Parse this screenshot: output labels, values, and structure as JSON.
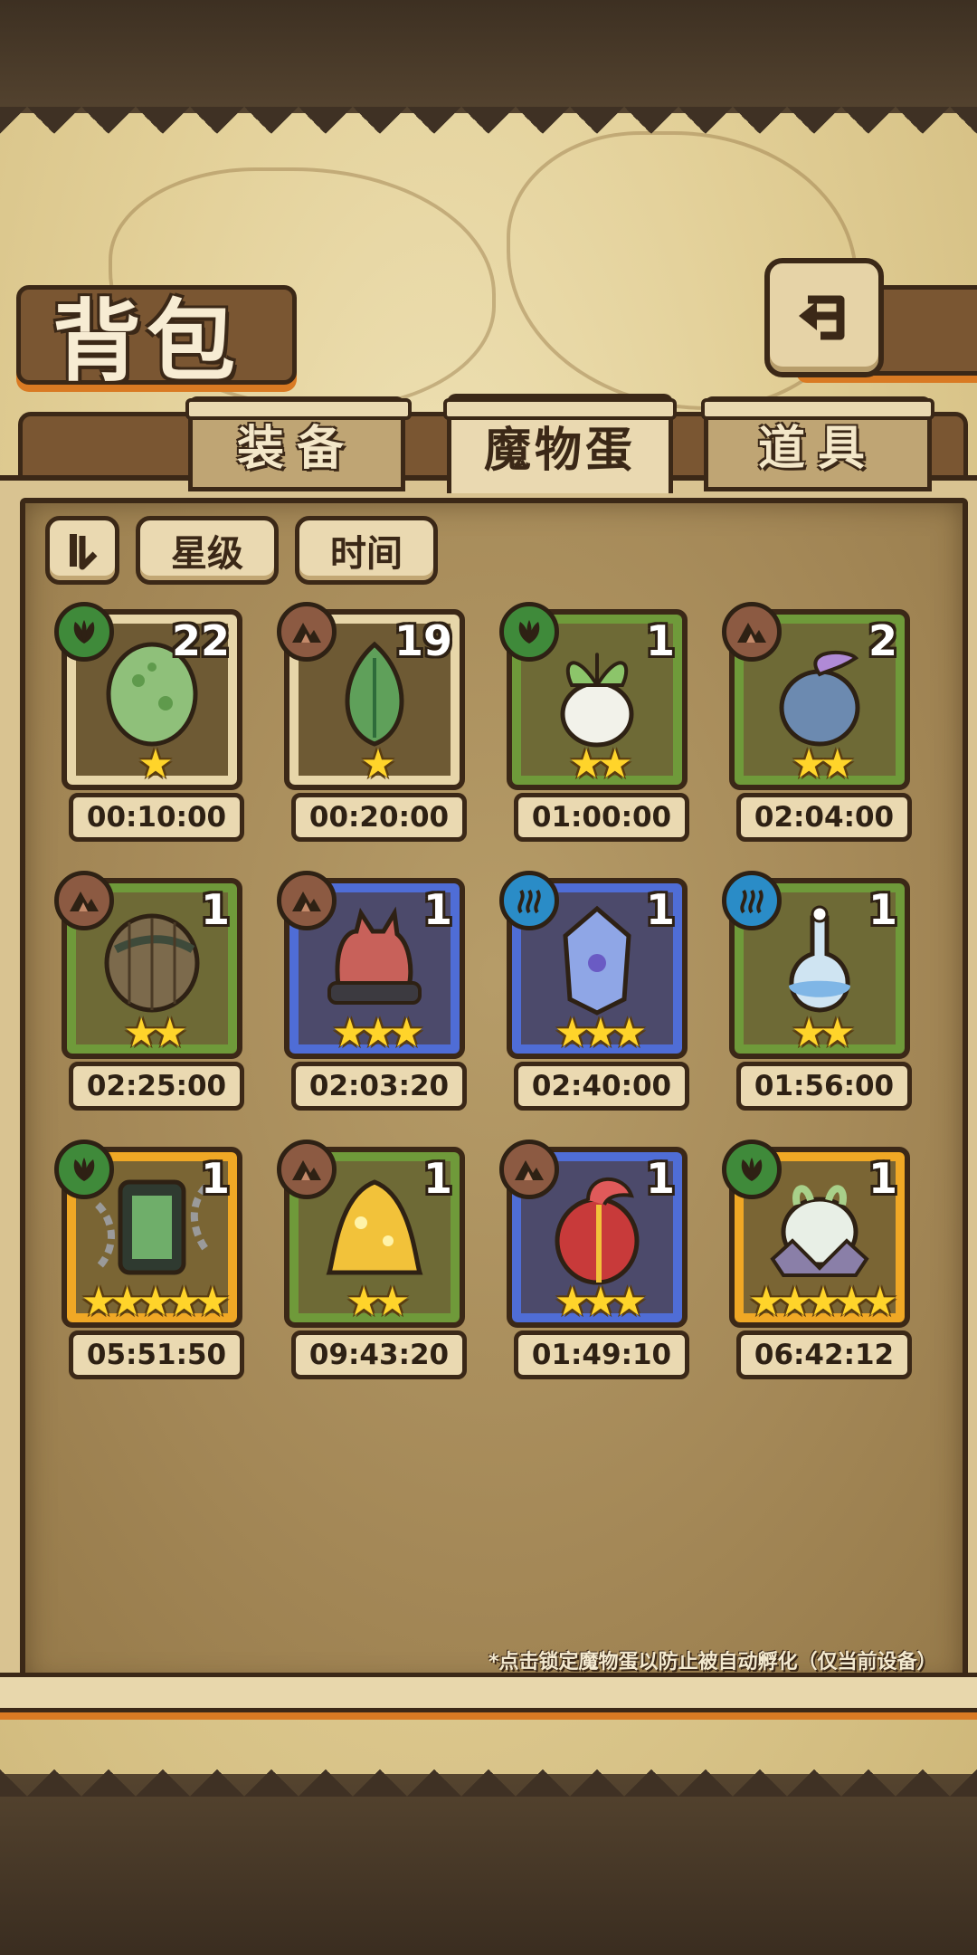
{
  "header": {
    "title": "背包"
  },
  "tabs": [
    {
      "label": "装备",
      "active": false
    },
    {
      "label": "魔物蛋",
      "active": true
    },
    {
      "label": "道具",
      "active": false
    }
  ],
  "sort": {
    "star_label": "星级",
    "time_label": "时间"
  },
  "eggs": [
    {
      "element": "grass",
      "count": "22",
      "stars": 1,
      "frame": "tan",
      "timer": "00:10:00",
      "art": "green-slime-egg"
    },
    {
      "element": "earth",
      "count": "19",
      "stars": 1,
      "frame": "tan",
      "timer": "00:20:00",
      "art": "leaf-bud-egg"
    },
    {
      "element": "grass",
      "count": "1",
      "stars": 2,
      "frame": "green",
      "timer": "01:00:00",
      "art": "turnip-egg"
    },
    {
      "element": "earth",
      "count": "2",
      "stars": 2,
      "frame": "green",
      "timer": "02:04:00",
      "art": "blue-sprout-egg"
    },
    {
      "element": "earth",
      "count": "1",
      "stars": 2,
      "frame": "green",
      "timer": "02:25:00",
      "art": "wrapped-coconut-egg"
    },
    {
      "element": "earth",
      "count": "1",
      "stars": 3,
      "frame": "blue",
      "timer": "02:03:20",
      "art": "red-cat-hood-egg"
    },
    {
      "element": "water",
      "count": "1",
      "stars": 3,
      "frame": "blue",
      "timer": "02:40:00",
      "art": "crystal-bottle-egg"
    },
    {
      "element": "water",
      "count": "1",
      "stars": 2,
      "frame": "green",
      "timer": "01:56:00",
      "art": "water-flask-egg"
    },
    {
      "element": "grass",
      "count": "1",
      "stars": 5,
      "frame": "gold",
      "timer": "05:51:50",
      "art": "chained-tablet-egg"
    },
    {
      "element": "earth",
      "count": "1",
      "stars": 2,
      "frame": "green",
      "timer": "09:43:20",
      "art": "gold-slime-egg"
    },
    {
      "element": "earth",
      "count": "1",
      "stars": 3,
      "frame": "blue",
      "timer": "01:49:10",
      "art": "spartan-helmet-egg"
    },
    {
      "element": "grass",
      "count": "1",
      "stars": 5,
      "frame": "gold",
      "timer": "06:42:12",
      "art": "crowned-white-egg"
    }
  ],
  "hint": "*点击锁定魔物蛋以防止被自动孵化（仅当前设备）",
  "colors": {
    "frame_tan": "#e7d6a9",
    "frame_green": "#6f9a3a",
    "frame_blue": "#4f6dd6",
    "frame_gold": "#f0a825",
    "element_grass": "#3f8a3a",
    "element_earth": "#8c5a42",
    "element_water": "#2a8cc7",
    "star": "#ffd42a"
  }
}
